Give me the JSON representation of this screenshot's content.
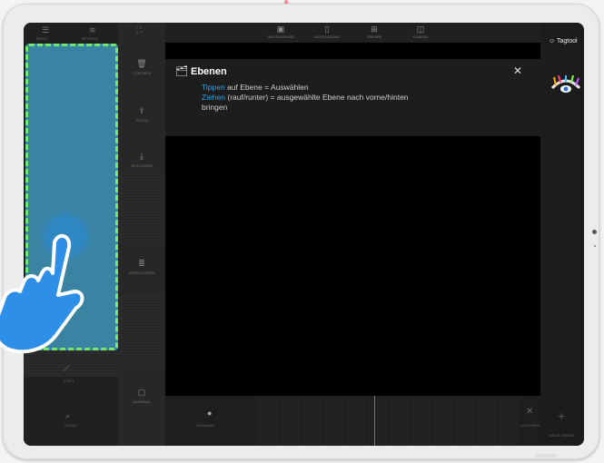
{
  "toptabs": [
    {
      "icon": "image-icon",
      "label": "HINTERGRUND"
    },
    {
      "icon": "file-icon",
      "label": "UNTERGRUND"
    },
    {
      "icon": "grid-icon",
      "label": "EBENEN"
    },
    {
      "icon": "camera-icon",
      "label": "KAMERA"
    }
  ],
  "left_top": [
    "MENÜ",
    "",
    "ÖFFNEN"
  ],
  "sidebar2": [
    {
      "icon": "trash-icon",
      "label": "LÖSCHEN"
    },
    {
      "icon": "share-icon",
      "label": "TEILEN"
    },
    {
      "icon": "download-icon",
      "label": "SPEICHERN"
    },
    {
      "icon": "layers-icon",
      "label": "VERSCHIEBEN"
    },
    {
      "icon": "select-icon",
      "label": "AUSWAHL"
    }
  ],
  "left_tools": [
    {
      "icon": "pen-icon",
      "label": "STIFT"
    },
    {
      "icon": "search-icon",
      "label": "ZOOM"
    }
  ],
  "info": {
    "title": "Ebenen",
    "line1_kw": "Tippen",
    "line1_rest": " auf Ebene = Auswählen",
    "line2_kw": "Ziehen",
    "line2_rest": " (rauf/runter) = ausgewählte Ebene nach vorne/hinten",
    "line3": "bringen"
  },
  "brand": "Tagtool",
  "bottom": {
    "left_label": "AUSWAHL",
    "right_label": "LÖSCHEN",
    "add_label": "NEUE EBENE"
  },
  "colors": {
    "accent_blue": "#2fa2e0",
    "highlight": "#3b83a2",
    "dash_green": "#6fe86b"
  }
}
